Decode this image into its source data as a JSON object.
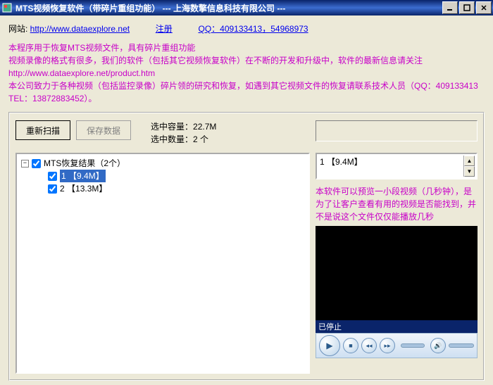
{
  "window": {
    "title": "MTS视频恢复软件（带碎片重组功能）       --- 上海数擎信息科技有限公司 ---"
  },
  "top": {
    "site_label": "网站: ",
    "site_url": "http://www.dataexplore.net",
    "register": "注册",
    "qq_label": "QQ：409133413，54968973"
  },
  "desc": {
    "line1": "本程序用于恢复MTS视频文件，具有碎片重组功能",
    "line2a": "视频录像的格式有很多，我们的软件（包括其它视频恢复软件）在不断的开发和升级中，软件的最新信息请关注 ",
    "line2b": "http://www.dataexplore.net/product.htm",
    "line3": "本公司致力于各种视频（包括监控录像）碎片领的研究和恢复，如遇到其它视频文件的恢复请联系技术人员（QQ：409133413   TEL：13872883452）。"
  },
  "buttons": {
    "rescan": "重新扫描",
    "save": "保存数据"
  },
  "stats": {
    "size_label": "选中容量：",
    "size_value": "22.7M",
    "count_label": "选中数量：",
    "count_value": "2 个"
  },
  "tree": {
    "root": "MTS恢复结果（2个）",
    "items": [
      {
        "idx": "1",
        "label": "【9.4M】"
      },
      {
        "idx": "2",
        "label": "【13.3M】"
      }
    ]
  },
  "filelist": {
    "item": "1 【9.4M】"
  },
  "preview_note": "本软件可以预览一小段视频（几秒钟），是为了让客户查看有用的视频是否能找到，并不是说这个文件仅仅能播放几秒",
  "player_status": "已停止"
}
